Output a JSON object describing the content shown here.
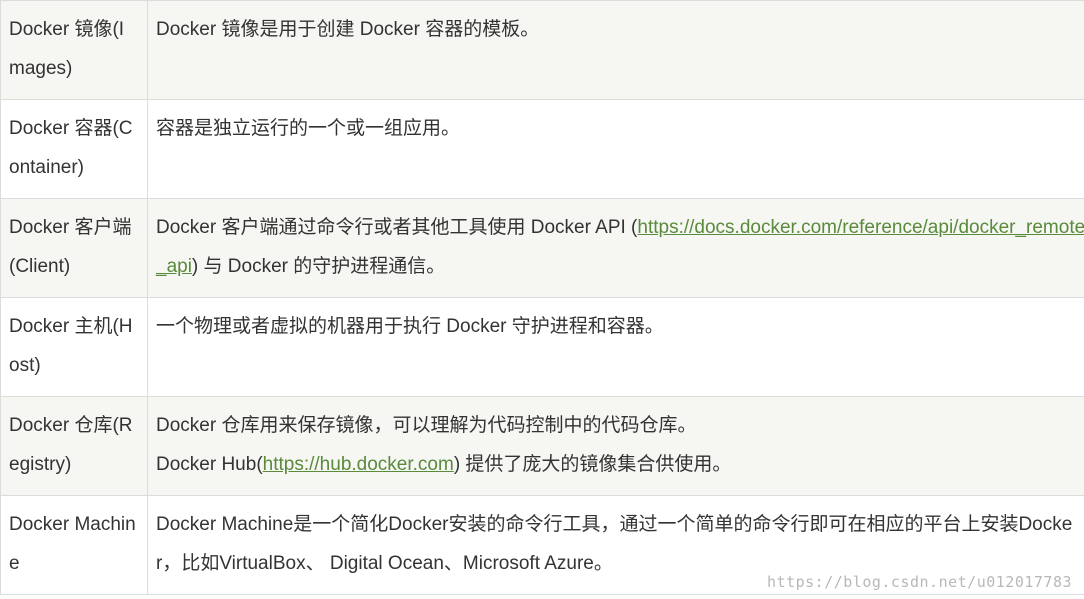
{
  "rows": [
    {
      "term": "Docker 镜像(Images)",
      "desc": [
        {
          "text": "Docker 镜像是用于创建 Docker 容器的模板。"
        }
      ]
    },
    {
      "term": "Docker 容器(Container)",
      "desc": [
        {
          "text": "容器是独立运行的一个或一组应用。"
        }
      ]
    },
    {
      "term": "Docker 客户端(Client)",
      "desc_prefix": "Docker 客户端通过命令行或者其他工具使用 Docker API (",
      "desc_link": "https://docs.docker.com/reference/api/docker_remote_api",
      "desc_suffix": ") 与 Docker 的守护进程通信。"
    },
    {
      "term": "Docker 主机(Host)",
      "desc": [
        {
          "text": "一个物理或者虚拟的机器用于执行 Docker 守护进程和容器。"
        }
      ]
    },
    {
      "term": "Docker 仓库(Registry)",
      "desc_line1": "Docker 仓库用来保存镜像，可以理解为代码控制中的代码仓库。",
      "desc_line2_prefix": "Docker Hub(",
      "desc_line2_link": "https://hub.docker.com",
      "desc_line2_suffix": ") 提供了庞大的镜像集合供使用。"
    },
    {
      "term": "Docker Machine",
      "desc": [
        {
          "text": "Docker Machine是一个简化Docker安装的命令行工具，通过一个简单的命令行即可在相应的平台上安装Docker，比如VirtualBox、 Digital Ocean、Microsoft Azure。"
        }
      ]
    }
  ],
  "watermark": "https://blog.csdn.net/u012017783",
  "colors": {
    "text": "#333333",
    "link": "#5a8a3c",
    "border": "#dcdcdc",
    "row_alt": "#f6f6f3"
  }
}
